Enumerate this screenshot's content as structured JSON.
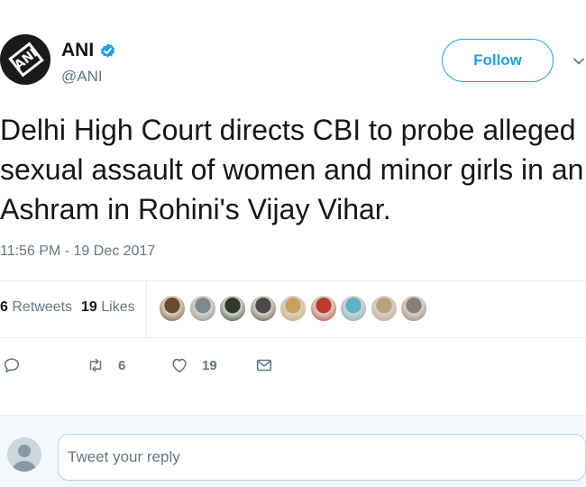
{
  "author": {
    "display_name": "ANI",
    "handle": "@ANI",
    "avatar_logo_text": "ANI",
    "verified": true
  },
  "follow_button": {
    "label": "Follow"
  },
  "tweet": {
    "text_lines": [
      "Delhi High Court directs CBI to probe alleged",
      "sexual assault of women and minor girls in an",
      "Ashram in Rohini's Vijay Vihar."
    ],
    "timestamp": "11:56 PM - 19 Dec 2017"
  },
  "stats": {
    "retweets_count": "6",
    "retweets_label": "Retweets",
    "likes_count": "19",
    "likes_label": "Likes"
  },
  "likers": [
    {
      "color": "#6b4a2e"
    },
    {
      "color": "#7c8a8f"
    },
    {
      "color": "#2f3a2c"
    },
    {
      "color": "#4a4a4a"
    },
    {
      "color": "#c9a15a"
    },
    {
      "color": "#c0392b"
    },
    {
      "color": "#5fb3c7"
    },
    {
      "color": "#b8a27a"
    },
    {
      "color": "#8a7f78"
    }
  ],
  "actions": {
    "reply_count": "",
    "retweet_count": "6",
    "like_count": "19"
  },
  "reply": {
    "placeholder": "Tweet your reply"
  },
  "colors": {
    "accent": "#1da1f2",
    "secondary_text": "#657786",
    "divider": "#e6ecf0"
  },
  "icons": [
    "verified-badge-icon",
    "chevron-down-icon",
    "reply-icon",
    "retweet-icon",
    "heart-icon",
    "envelope-icon",
    "default-avatar-icon"
  ]
}
